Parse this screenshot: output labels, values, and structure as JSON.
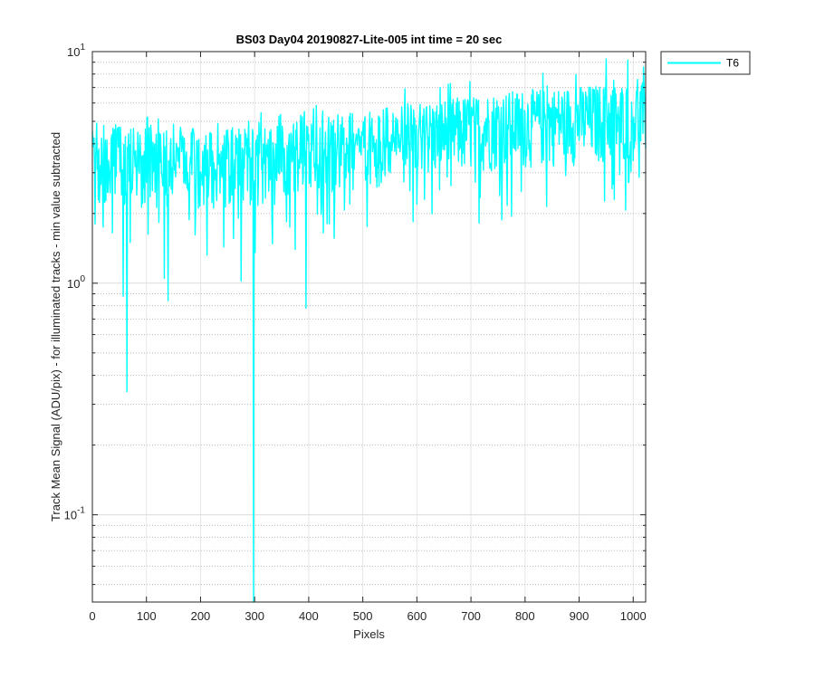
{
  "chart_data": {
    "type": "line",
    "title": "BS03 Day04 20190827-Lite-005 int time = 20 sec",
    "xlabel": "Pixels",
    "ylabel": "Track Mean Signal (ADU/pix) - for illuminated tracks - min value subtracted",
    "xlim": [
      0,
      1023
    ],
    "ylim": [
      0.042,
      10
    ],
    "yscale": "log",
    "grid": true,
    "legend_position": "top-right, outside plot",
    "x_ticks": [
      "0",
      "100",
      "200",
      "300",
      "400",
      "500",
      "600",
      "700",
      "800",
      "900",
      "1000"
    ],
    "y_ticks": [
      {
        "value": 0.1,
        "base": "10",
        "exp": "-1"
      },
      {
        "value": 1,
        "base": "10",
        "exp": "0"
      },
      {
        "value": 10,
        "base": "10",
        "exp": "1"
      }
    ],
    "series": [
      {
        "name": "T6",
        "color": "#00FFFF",
        "x_start": 0,
        "x_step": 1,
        "trend": [
          {
            "x": 0,
            "y": 3.6
          },
          {
            "x": 150,
            "y": 3.3
          },
          {
            "x": 300,
            "y": 3.4
          },
          {
            "x": 450,
            "y": 3.9
          },
          {
            "x": 600,
            "y": 4.4
          },
          {
            "x": 750,
            "y": 4.9
          },
          {
            "x": 900,
            "y": 5.2
          },
          {
            "x": 1023,
            "y": 5.4
          }
        ],
        "notable_points": [
          {
            "x": 5,
            "y": 1.8
          },
          {
            "x": 57,
            "y": 0.88
          },
          {
            "x": 64,
            "y": 0.34
          },
          {
            "x": 70,
            "y": 1.5
          },
          {
            "x": 140,
            "y": 0.84
          },
          {
            "x": 133,
            "y": 1.05
          },
          {
            "x": 275,
            "y": 1.02
          },
          {
            "x": 298,
            "y": 0.042
          },
          {
            "x": 395,
            "y": 0.78
          },
          {
            "x": 375,
            "y": 1.4
          },
          {
            "x": 775,
            "y": 1.95
          },
          {
            "x": 950,
            "y": 9.3
          },
          {
            "x": 990,
            "y": 9.2
          },
          {
            "x": 965,
            "y": 2.3
          }
        ]
      }
    ]
  }
}
